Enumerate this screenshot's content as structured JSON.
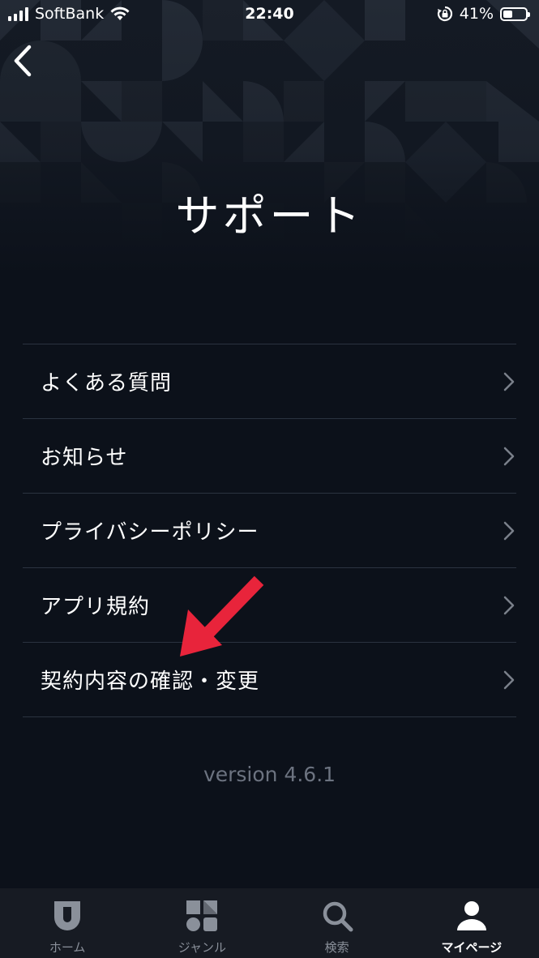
{
  "status_bar": {
    "carrier": "SoftBank",
    "time": "22:40",
    "battery_percent": "41%",
    "battery_level": 0.41
  },
  "header": {
    "back_icon": "chevron-left-icon",
    "title": "サポート"
  },
  "menu": {
    "items": [
      {
        "label": "よくある質問"
      },
      {
        "label": "お知らせ"
      },
      {
        "label": "プライバシーポリシー"
      },
      {
        "label": "アプリ規約"
      },
      {
        "label": "契約内容の確認・変更"
      }
    ],
    "chevron_icon": "chevron-right-icon"
  },
  "version": "version 4.6.1",
  "annotation": {
    "arrow_color": "#e8243b"
  },
  "tab_bar": {
    "tabs": [
      {
        "label": "ホーム",
        "icon": "shield-icon",
        "active": false
      },
      {
        "label": "ジャンル",
        "icon": "genre-grid-icon",
        "active": false
      },
      {
        "label": "検索",
        "icon": "search-icon",
        "active": false
      },
      {
        "label": "マイページ",
        "icon": "user-icon",
        "active": true
      }
    ]
  },
  "colors": {
    "background": "#0c111a",
    "tab_bar": "#171b23",
    "divider": "#2b3340",
    "version_text": "#6c7380",
    "inactive_tab": "#8a909a"
  }
}
